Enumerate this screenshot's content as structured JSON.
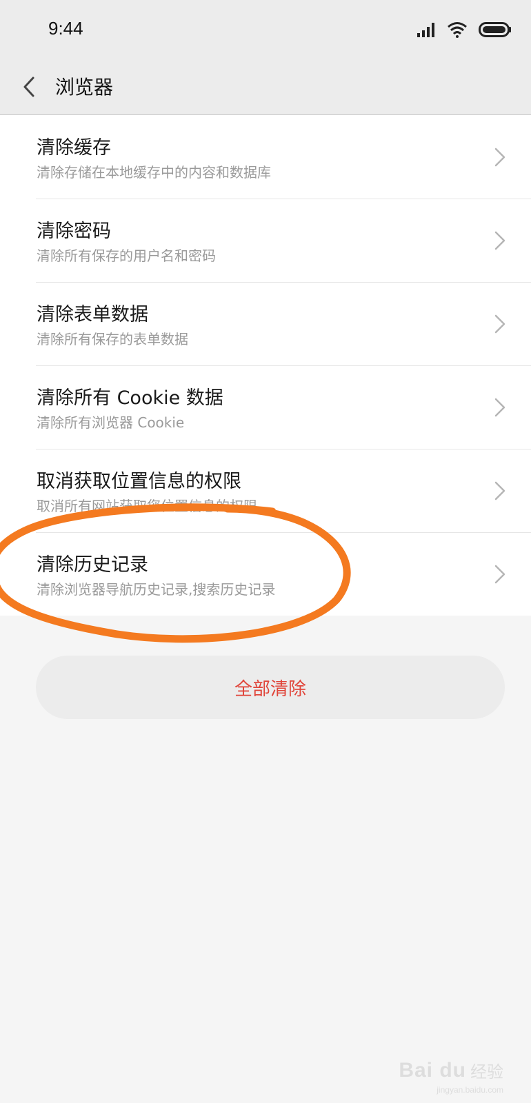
{
  "status_bar": {
    "time": "9:44",
    "icons": [
      "signal-icon",
      "wifi-icon",
      "battery-icon"
    ]
  },
  "app_bar": {
    "back_icon": "chevron-left-icon",
    "title": "浏览器"
  },
  "items": [
    {
      "title": "清除缓存",
      "subtitle": "清除存储在本地缓存中的内容和数据库"
    },
    {
      "title": "清除密码",
      "subtitle": "清除所有保存的用户名和密码"
    },
    {
      "title": "清除表单数据",
      "subtitle": "清除所有保存的表单数据"
    },
    {
      "title": "清除所有 Cookie 数据",
      "subtitle": "清除所有浏览器 Cookie"
    },
    {
      "title": "取消获取位置信息的权限",
      "subtitle": "取消所有网站获取您位置信息的权限"
    },
    {
      "title": "清除历史记录",
      "subtitle": "清除浏览器导航历史记录,搜索历史记录"
    }
  ],
  "clear_all_button": {
    "label": "全部清除"
  },
  "watermark": {
    "logo": "Bai du",
    "text": "经验",
    "url": "jingyan.baidu.com"
  },
  "colors": {
    "accent_red": "#e0453a",
    "annotation_orange": "#f47a20",
    "background": "#f5f5f5",
    "bar_background": "#ececec"
  }
}
